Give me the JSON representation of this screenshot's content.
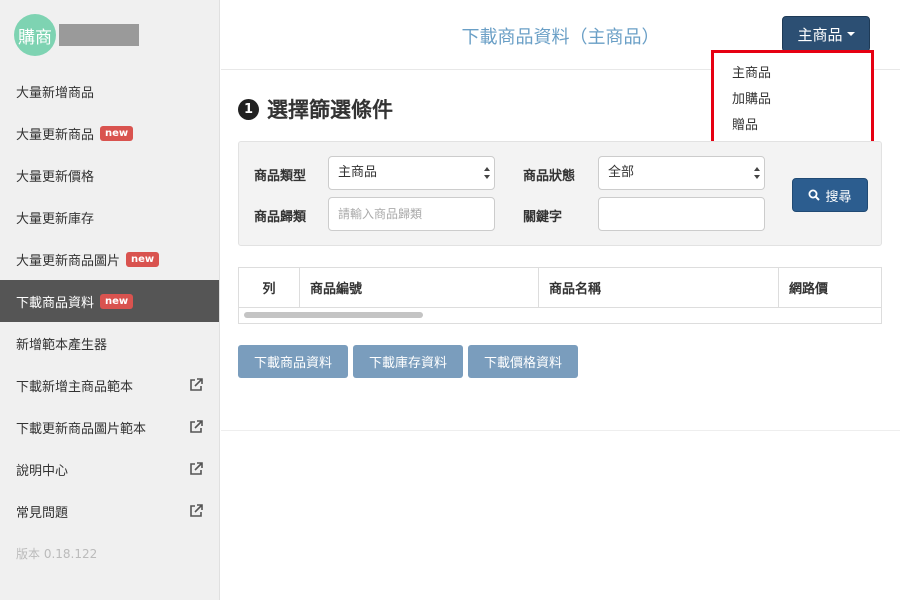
{
  "sidebar": {
    "logo_text": "購商",
    "items": [
      {
        "label": "大量新增商品",
        "badge": ""
      },
      {
        "label": "大量更新商品",
        "badge": "new"
      },
      {
        "label": "大量更新價格",
        "badge": ""
      },
      {
        "label": "大量更新庫存",
        "badge": ""
      },
      {
        "label": "大量更新商品圖片",
        "badge": "new"
      },
      {
        "label": "下載商品資料",
        "badge": "new"
      },
      {
        "label": "新增範本產生器",
        "badge": ""
      },
      {
        "label": "下載新增主商品範本",
        "badge": ""
      },
      {
        "label": "下載更新商品圖片範本",
        "badge": ""
      },
      {
        "label": "說明中心",
        "badge": ""
      },
      {
        "label": "常見問題",
        "badge": ""
      }
    ],
    "version": "版本 0.18.122"
  },
  "header": {
    "title": "下載商品資料（主商品）",
    "dropdown_label": "主商品",
    "dropdown_options": [
      "主商品",
      "加購品",
      "贈品"
    ]
  },
  "main": {
    "section_number": "1",
    "section_title": "選擇篩選條件",
    "filters": {
      "type_label": "商品類型",
      "type_value": "主商品",
      "status_label": "商品狀態",
      "status_value": "全部",
      "category_label": "商品歸類",
      "category_placeholder": "請輸入商品歸類",
      "keyword_label": "關鍵字",
      "keyword_value": "",
      "search_label": "搜尋"
    },
    "table": {
      "columns": [
        "列",
        "商品編號",
        "商品名稱",
        "網路價"
      ]
    },
    "buttons": {
      "download_product": "下載商品資料",
      "download_stock": "下載庫存資料",
      "download_price": "下載價格資料"
    }
  },
  "colors": {
    "active_nav": "#555555",
    "badge": "#d9534f",
    "primary_button": "#2c4f73",
    "title_blue": "#6a9fc6",
    "highlight_border": "#e60012"
  }
}
